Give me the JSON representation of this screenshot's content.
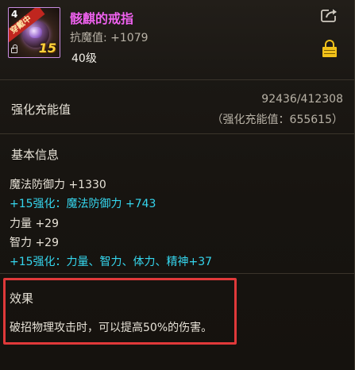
{
  "item": {
    "corner_number": "4",
    "ribbon_text": "穿戴中",
    "enhance_level": "15",
    "name": "骸麒的戒指",
    "resist": "抗魔值: +1079",
    "level": "40级"
  },
  "colors": {
    "name": "#f062f0",
    "enhance_stat": "#35d6ee",
    "lock": "#f2c21a",
    "highlight_border": "#e0393a"
  },
  "icons": [
    "ring-item-icon",
    "share-icon",
    "lock-icon"
  ],
  "charge": {
    "label": "强化充能值",
    "value": "92436/412308",
    "sub": "（强化充能值：655615）"
  },
  "basic": {
    "title": "基本信息",
    "stats": [
      {
        "text": "魔法防御力 +1330",
        "style": "normal"
      },
      {
        "text": "+15强化：魔法防御力 +743",
        "style": "cyan"
      },
      {
        "text": "力量 +29",
        "style": "normal"
      },
      {
        "text": "智力 +29",
        "style": "normal"
      },
      {
        "text": "+15强化：力量、智力、体力、精神+37",
        "style": "cyan"
      }
    ]
  },
  "effect": {
    "title": "效果",
    "text": "破招物理攻击时，可以提高50%的伤害。"
  }
}
